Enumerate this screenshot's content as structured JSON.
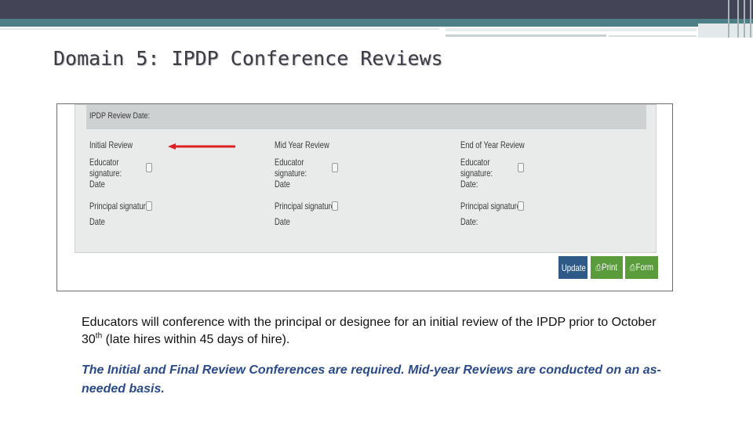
{
  "slide": {
    "title": "Domain 5: IPDP Conference Reviews",
    "accent_color": "#2a4a8a",
    "topbar_color": "#434557",
    "teal_color": "#4d7f86"
  },
  "form": {
    "header_label": "IPDP Review Date:",
    "columns": [
      {
        "title": "Initial Review",
        "educator_label_line1": "Educator",
        "educator_label_line2": "signature:",
        "date_label_1": "Date",
        "principal_label": "Principal signature:",
        "date_label_2": "Date"
      },
      {
        "title": "Mid Year Review",
        "educator_label_line1": "Educator",
        "educator_label_line2": "signature:",
        "date_label_1": "Date",
        "principal_label": "Principal signature:",
        "date_label_2": "Date"
      },
      {
        "title": "End of Year Review",
        "educator_label_line1": "Educator",
        "educator_label_line2": "signature:",
        "date_label_1": "Date:",
        "principal_label": "Principal signature:",
        "date_label_2": "Date:"
      }
    ],
    "buttons": {
      "update": "Update",
      "print": "Print",
      "form": "Form"
    },
    "arrow_color": "#e02020"
  },
  "body": {
    "text_before_sup": "Educators will conference with the principal or designee for an initial review of the IPDP prior to October 30",
    "sup": "th",
    "text_after_sup": " (late hires within 45 days of hire).",
    "note": "The Initial and Final Review Conferences are required. Mid-year Reviews are conducted on an as-needed basis."
  }
}
